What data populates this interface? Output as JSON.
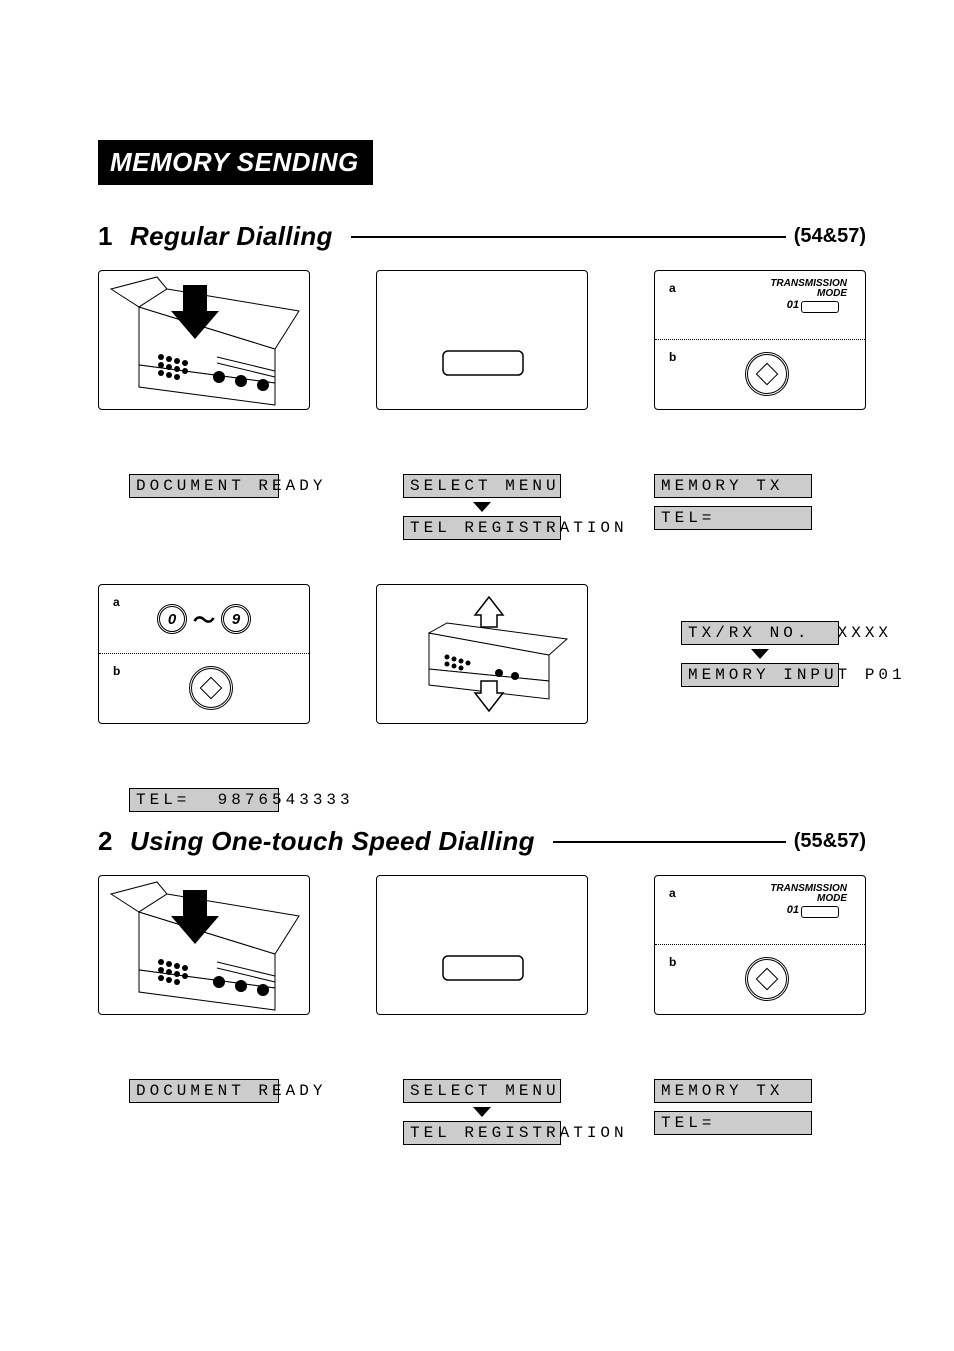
{
  "banner": "MEMORY SENDING",
  "section1": {
    "num": "1",
    "title": "Regular Dialling",
    "pageref": "(54&57)",
    "panel3": {
      "a_label": "a",
      "b_label": "b",
      "tm_line1": "TRANSMISSION",
      "tm_line2": "MODE",
      "tm_01": "01"
    },
    "lcd": {
      "doc_ready": "DOCUMENT READY",
      "select_menu": "SELECT MENU",
      "tel_reg": "TEL REGISTRATION",
      "memory_tx": "MEMORY TX",
      "tel_eq": "TEL="
    },
    "panel4": {
      "a_label": "a",
      "b_label": "b",
      "key0": "0",
      "key9": "9",
      "tilde": "〜"
    },
    "lcd2": {
      "txrx": "TX/RX NO.  XXXX",
      "mem_in": "MEMORY INPUT P01",
      "tel_num": "TEL=  9876543333"
    }
  },
  "section2": {
    "num": "2",
    "title": "Using One-touch Speed Dialling",
    "pageref": "(55&57)",
    "panel3": {
      "a_label": "a",
      "b_label": "b",
      "tm_line1": "TRANSMISSION",
      "tm_line2": "MODE",
      "tm_01": "01"
    },
    "lcd": {
      "doc_ready": "DOCUMENT READY",
      "select_menu": "SELECT MENU",
      "tel_reg": "TEL REGISTRATION",
      "memory_tx": "MEMORY TX",
      "tel_eq": "TEL="
    }
  }
}
